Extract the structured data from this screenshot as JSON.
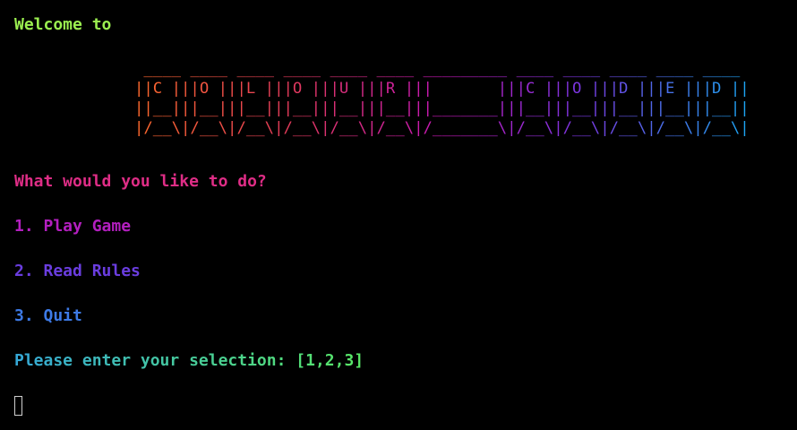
{
  "welcome": "Welcome to",
  "banner": {
    "lines": [
      " ____ ____ ____ ____ ____ ____ _________ ____ ____ ____ ____ ____",
      "||C |||O |||L |||O |||U |||R |||       |||C |||O |||D |||E |||D ||",
      "||__|||__|||__|||__|||__|||__|||_______|||__|||__|||__|||__|||__||",
      "|/__\\|/__\\|/__\\|/__\\|/__\\|/__\\|/_______\\|/__\\|/__\\|/__\\|/__\\|/__\\|"
    ]
  },
  "prompt": "What would you like to do?",
  "menu": [
    {
      "label": "1. Play Game"
    },
    {
      "label": "2. Read Rules"
    },
    {
      "label": "3. Quit"
    }
  ],
  "input_prompt": "Please enter your selection: [1,2,3]",
  "colors": {
    "welcome": "#9bef50",
    "prompt": "#df2d86",
    "menu_1": "#b31fbf",
    "menu_2": "#6a3ddf",
    "menu_3": "#3d7ae6",
    "input_start": "#35a8d8",
    "input_end": "#59e865",
    "banner_start": "#ff5a2c",
    "banner_mid": "#c617b8",
    "banner_end": "#1aa6f2",
    "cursor": "#cfcfcf"
  }
}
